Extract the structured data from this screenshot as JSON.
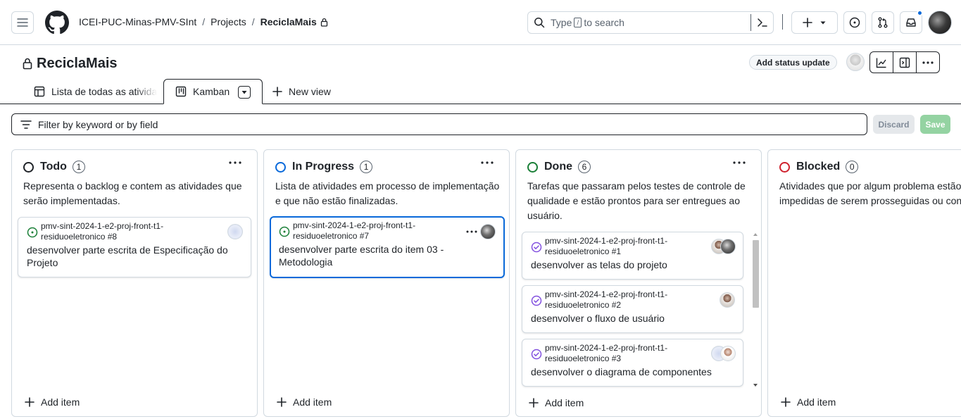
{
  "header": {
    "breadcrumb": [
      "ICEI-PUC-Minas-PMV-SInt",
      "Projects",
      "ReciclaMais"
    ],
    "search": {
      "prefix": "Type",
      "key": "/",
      "suffix": "to search"
    }
  },
  "project": {
    "title": "ReciclaMais",
    "status_button": "Add status update"
  },
  "views": {
    "tabs": [
      {
        "label": "Lista de todas as atividades",
        "icon": "table-icon"
      },
      {
        "label": "Kamban",
        "icon": "board-icon",
        "active": true
      },
      {
        "label": "New view",
        "icon": "plus-icon"
      }
    ]
  },
  "filter": {
    "placeholder": "Filter by keyword or by field",
    "discard_label": "Discard",
    "save_label": "Save"
  },
  "columns": [
    {
      "name": "Todo",
      "count": "1",
      "color": "#1f2328",
      "description": "Representa o backlog e contem as atividades que serão implementadas.",
      "add_label": "Add item",
      "cards": [
        {
          "repo": "pmv-sint-2024-1-e2-proj-front-t1-residuoeletronico #8",
          "title": "desenvolver parte escrita de Especificação do Projeto",
          "state": "open"
        }
      ]
    },
    {
      "name": "In Progress",
      "count": "1",
      "color": "#0969da",
      "description": "Lista de atividades em processo de implementação e que não estão finalizadas.",
      "add_label": "Add item",
      "cards": [
        {
          "repo": "pmv-sint-2024-1-e2-proj-front-t1-residuoeletronico #7",
          "title": "desenvolver parte escrita do item 03 - Metodologia",
          "state": "open"
        }
      ]
    },
    {
      "name": "Done",
      "count": "6",
      "color": "#1a7f37",
      "description": "Tarefas que passaram pelos testes de controle de qualidade e estão prontos para ser entregues ao usuário.",
      "add_label": "Add item",
      "cards": [
        {
          "repo": "pmv-sint-2024-1-e2-proj-front-t1-residuoeletronico #1",
          "title": "desenvolver as telas do projeto",
          "state": "closed"
        },
        {
          "repo": "pmv-sint-2024-1-e2-proj-front-t1-residuoeletronico #2",
          "title": "desenvolver o fluxo de usuário",
          "state": "closed"
        },
        {
          "repo": "pmv-sint-2024-1-e2-proj-front-t1-residuoeletronico #3",
          "title": "desenvolver o diagrama de componentes",
          "state": "closed"
        }
      ]
    },
    {
      "name": "Blocked",
      "count": "0",
      "color": "#cf222e",
      "description": "Atividades que por algum problema estão impedidas de serem prosseguidas ou concluídas.",
      "add_label": "Add item",
      "cards": []
    }
  ]
}
